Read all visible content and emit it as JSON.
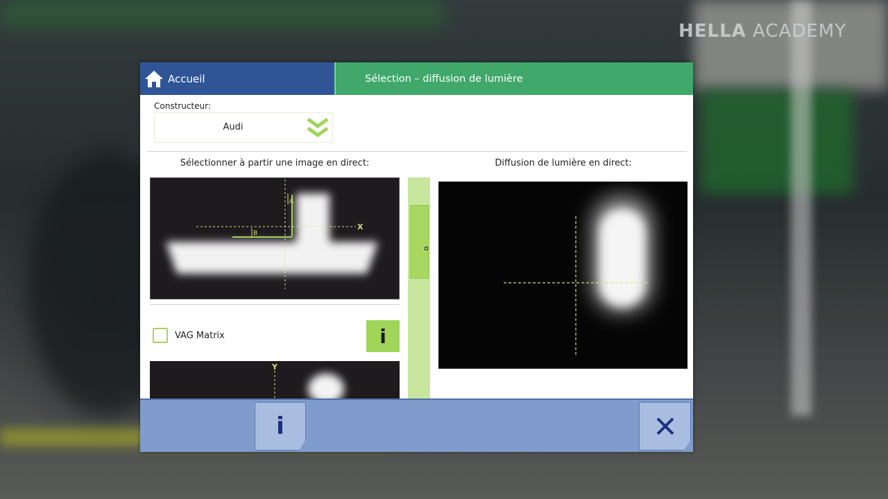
{
  "watermark": {
    "brand": "HELLA",
    "sub": "ACADEMY"
  },
  "titlebar": {
    "home_label": "Accueil",
    "title": "Sélection – diffusion de lumière",
    "home_color": "#2f5597",
    "title_color": "#3fa86a"
  },
  "constructor": {
    "label": "Constructeur:",
    "value": "Audi"
  },
  "left_panel": {
    "title": "Sélectionner à partir une image en direct:",
    "markers": {
      "a": "A",
      "b": "B",
      "x": "X",
      "y": "Y"
    }
  },
  "vag": {
    "label": "VAG Matrix",
    "checked": false,
    "info_label": "i"
  },
  "right_panel": {
    "title": "Diffusion de lumière en direct:"
  },
  "bottombar": {
    "info_label": "i",
    "close_icon": "close-x"
  },
  "colors": {
    "accent_green": "#9fd65a",
    "bottom_bar": "#7f9ccc"
  }
}
